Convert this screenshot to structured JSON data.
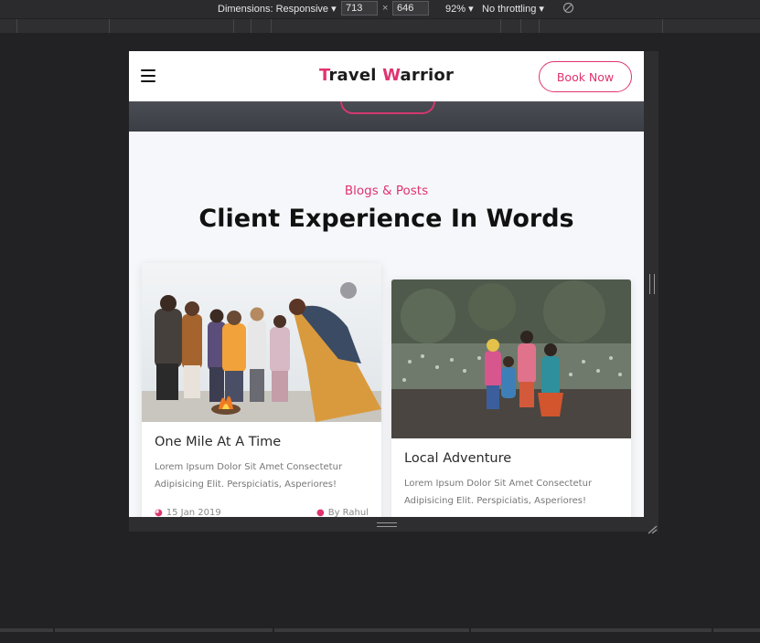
{
  "devtools": {
    "dimensions_label": "Dimensions: Responsive ▾",
    "width_value": "713",
    "times": "×",
    "height_value": "646",
    "zoom": "92% ▾",
    "throttling": "No throttling ▾"
  },
  "header": {
    "brand_first_initial": "T",
    "brand_first_rest": "ravel ",
    "brand_second_initial": "W",
    "brand_second_rest": "arrior",
    "book_label": "Book Now"
  },
  "section": {
    "subtitle": "Blogs & Posts",
    "title": "Client Experience In Words"
  },
  "cards": [
    {
      "title": "One Mile At A Time",
      "text": "Lorem Ipsum Dolor Sit Amet Consectetur Adipisicing Elit. Perspiciatis, Asperiores!",
      "date": "15 Jan 2019",
      "author": "By Rahul"
    },
    {
      "title": "Local Adventure",
      "text": "Lorem Ipsum Dolor Sit Amet Consectetur Adipisicing Elit. Perspiciatis, Asperiores!"
    }
  ],
  "colors": {
    "accent": "#e0336f",
    "devtools_bg": "#222225",
    "page_bg": "#f6f7fa"
  }
}
